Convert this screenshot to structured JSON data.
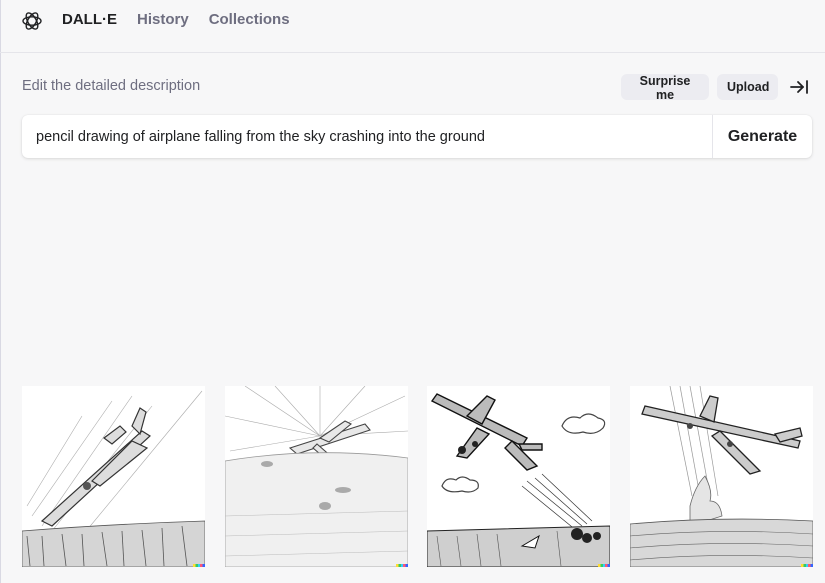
{
  "nav": {
    "brand": "DALL·E",
    "history": "History",
    "collections": "Collections"
  },
  "editor": {
    "label": "Edit the detailed description",
    "surprise_label": "Surprise me",
    "upload_label": "Upload",
    "prompt_value": "pencil drawing of airplane falling from the sky crashing into the ground",
    "generate_label": "Generate"
  },
  "icons": {
    "logo": "openai-logo-icon",
    "collapse": "collapse-panel-icon"
  },
  "colors": {
    "background": "#f7f7f8",
    "chip": "#ececf1",
    "text": "#202123",
    "muted": "#6e6e80"
  },
  "results": {
    "count": 4
  }
}
